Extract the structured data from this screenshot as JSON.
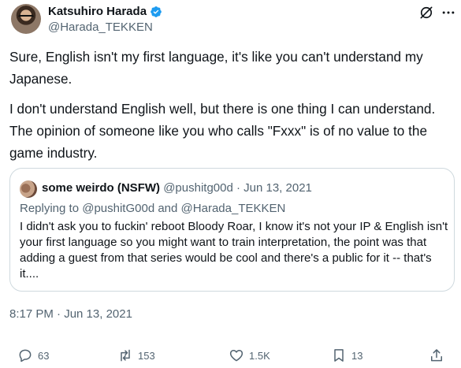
{
  "author": {
    "name": "Katsuhiro Harada",
    "handle": "@Harada_TEKKEN",
    "verified_color": "#1d9bf0"
  },
  "tweet": {
    "paragraphs": [
      "Sure, English isn't my first language, it's like you can't understand my Japanese.",
      "I don't understand English well, but there is one thing I can understand. The opinion of someone like you who calls \"Fxxx\" is of no value to the game industry."
    ],
    "timestamp": "8:17 PM · Jun 13, 2021"
  },
  "quote": {
    "name": "some weirdo (NSFW)",
    "handle_date": "@pushitg00d · Jun 13, 2021",
    "reply_prefix": "Replying to ",
    "reply_user1": "@pushitG00d",
    "reply_and": " and ",
    "reply_user2": "@Harada_TEKKEN",
    "text": "I didn't ask you to fuckin' reboot Bloody Roar, I know it's not your IP & English isn't your first language so you might want to train interpretation, the point was that adding a guest from that series would be cool and there's a public for it -- that's it...."
  },
  "actions": {
    "replies": "63",
    "reposts": "153",
    "likes": "1.5K",
    "bookmarks": "13"
  },
  "icons": {
    "grok": "grok-icon",
    "reply": "reply-icon",
    "repost": "repost-icon",
    "like": "heart-icon",
    "bookmark": "bookmark-icon",
    "share": "share-icon"
  },
  "colors": {
    "text": "#0f1419",
    "secondary": "#536471",
    "border": "#cfd9de",
    "accent": "#1d9bf0"
  }
}
